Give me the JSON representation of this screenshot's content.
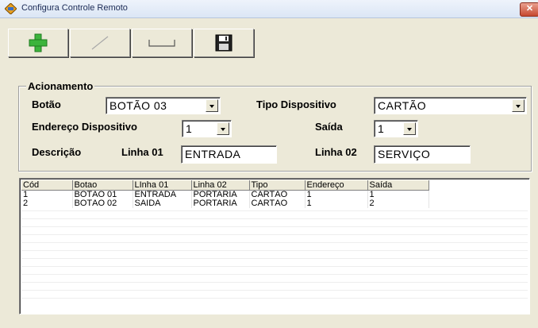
{
  "window": {
    "title": "Configura Controle Remoto",
    "close_label": "✕"
  },
  "toolbar": {
    "buttons": [
      {
        "name": "add",
        "icon": "plus-icon"
      },
      {
        "name": "edit",
        "icon": "pencil-line-icon"
      },
      {
        "name": "clear",
        "icon": "eraser-icon"
      },
      {
        "name": "save",
        "icon": "floppy-disk-icon"
      }
    ]
  },
  "form": {
    "group_title": "Acionamento",
    "botao_label": "Botão",
    "botao_value": "BOTÃO 03",
    "tipo_label": "Tipo Dispositivo",
    "tipo_value": "CARTÃO",
    "endereco_label": "Endereço Dispositivo",
    "endereco_value": "1",
    "saida_label": "Saída",
    "saida_value": "1",
    "descricao_label": "Descrição",
    "linha01_label": "Linha 01",
    "linha01_value": "ENTRADA",
    "linha02_label": "Linha 02",
    "linha02_value": "SERVIÇO"
  },
  "grid": {
    "columns": [
      "Cód",
      "Botao",
      "LInha 01",
      "Linha 02",
      "Tipo",
      "Endereço",
      "Saída"
    ],
    "rows": [
      [
        "1",
        "BOTÃO 01",
        "ENTRADA",
        "PORTARIA",
        "CARTÃO",
        "1",
        "1"
      ],
      [
        "2",
        "BOTÃO 02",
        "SAIDA",
        "PORTARIA",
        "CARTÃO",
        "1",
        "2"
      ]
    ]
  }
}
